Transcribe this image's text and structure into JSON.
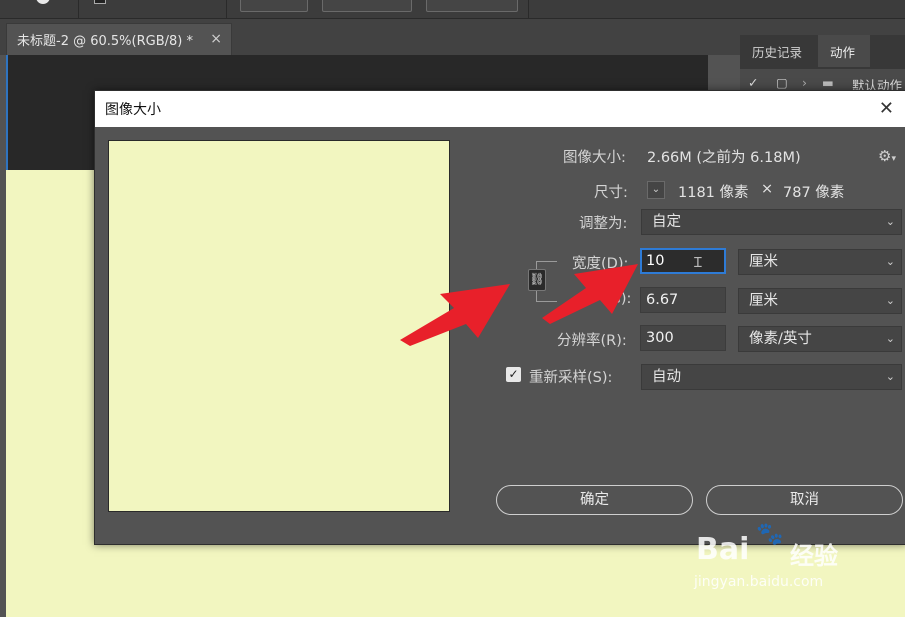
{
  "document_tab": {
    "title": "未标题-2 @ 60.5%(RGB/8) *",
    "close": "×"
  },
  "panel": {
    "tabs": [
      "历史记录",
      "动作"
    ],
    "row_label": "默认动作"
  },
  "dialog": {
    "title": "图像大小",
    "close": "✕",
    "image_size_label": "图像大小:",
    "image_size_value": "2.66M (之前为 6.18M)",
    "dimensions_label": "尺寸:",
    "dimensions_width": "1181 像素",
    "dimensions_times": "×",
    "dimensions_height": "787 像素",
    "fit_to_label": "调整为:",
    "fit_to_value": "自定",
    "width_label": "宽度(D):",
    "width_value": "10",
    "width_unit": "厘米",
    "height_label_partial": "(G):",
    "height_value": "6.67",
    "height_unit": "厘米",
    "resolution_label": "分辨率(R):",
    "resolution_value": "300",
    "resolution_unit": "像素/英寸",
    "resample_label": "重新采样(S):",
    "resample_checked": true,
    "resample_value": "自动",
    "ok_label": "确定",
    "cancel_label": "取消"
  },
  "watermark": {
    "brand": "Bai",
    "brand2": "经验",
    "url": "jingyan.baidu.com"
  },
  "colors": {
    "canvas_fill": "#f2f6c0",
    "focus_border": "#2e7bd6",
    "arrow": "#e8202a"
  }
}
